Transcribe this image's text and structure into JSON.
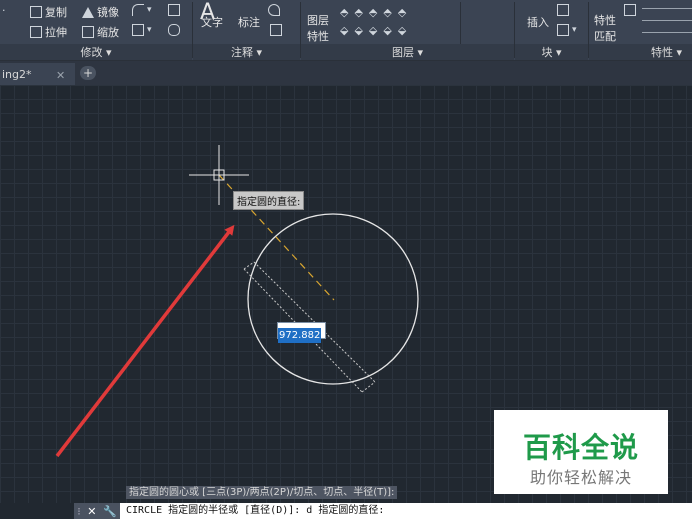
{
  "ribbon": {
    "modify": {
      "copy": "复制",
      "mirror": "镜像",
      "stretch": "拉伸",
      "scale": "缩放",
      "panel_label": "修改 ▾"
    },
    "annotate": {
      "text": "文字",
      "dimension": "标注",
      "panel_label": "注释 ▾"
    },
    "layers": {
      "layer_props": "图层",
      "layer_props2": "特性",
      "panel_label": "图层 ▾"
    },
    "block": {
      "insert": "插入",
      "panel_label": "块 ▾"
    },
    "properties": {
      "match": "特性",
      "match2": "匹配",
      "panel_label": "特性 ▾"
    }
  },
  "tabs": [
    {
      "label": "ing2*",
      "close": "✕"
    }
  ],
  "tab_add": "+",
  "canvas": {
    "tooltip": "指定圆的直径:",
    "dynamic_input_value": "972.882"
  },
  "command": {
    "history": "指定圆的圆心或 [三点(3P)/两点(2P)/切点、切点、半径(T)]:",
    "current": "CIRCLE 指定圆的半径或 [直径(D)]: d 指定圆的直径:"
  },
  "watermark": {
    "title": "百科全说",
    "subtitle": "助你轻松解决"
  },
  "colors": {
    "canvas_bg": "#212830",
    "ribbon_bg": "#3b4453",
    "arrow": "#e03a3a",
    "dashed_line": "#d9a630",
    "circle": "#e6e6e6",
    "watermark_green": "#1f9a4a"
  }
}
